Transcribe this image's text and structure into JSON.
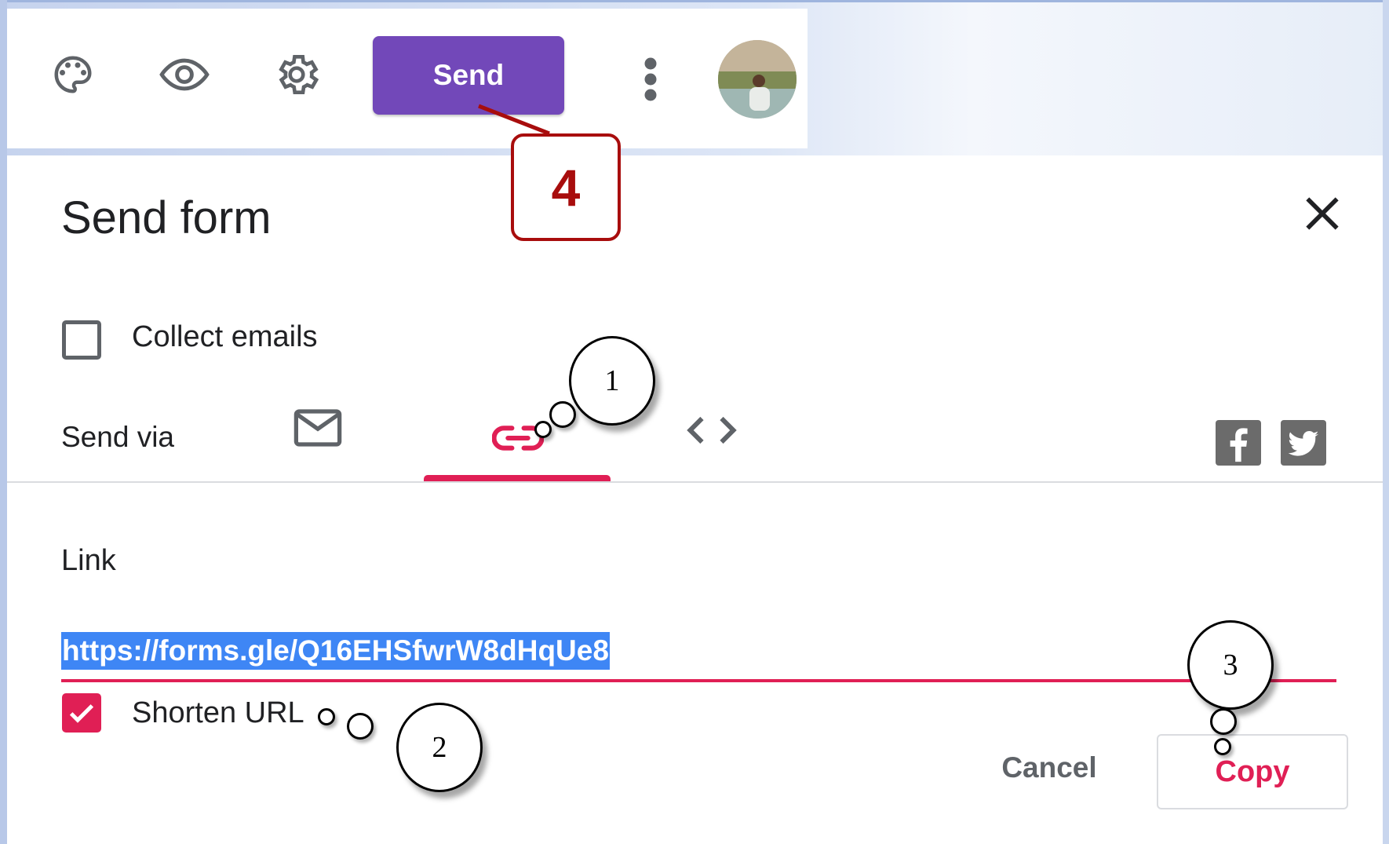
{
  "toolbar": {
    "icons": [
      "palette-icon",
      "eye-icon",
      "gear-icon",
      "more-vert-icon"
    ],
    "send_label": "Send"
  },
  "dialog": {
    "title": "Send form",
    "collect_emails_label": "Collect emails",
    "collect_emails_checked": false,
    "send_via_label": "Send via",
    "tabs": [
      {
        "icon": "email-icon",
        "selected": false
      },
      {
        "icon": "link-icon",
        "selected": true
      },
      {
        "icon": "embed-icon",
        "selected": false
      }
    ],
    "share_icons": [
      "facebook-icon",
      "twitter-icon"
    ],
    "link_label": "Link",
    "url": "https://forms.gle/Q16EHSfwrW8dHqUe8",
    "shorten_url_label": "Shorten URL",
    "shorten_url_checked": true,
    "cancel_label": "Cancel",
    "copy_label": "Copy"
  },
  "annotations": {
    "a1": "1",
    "a2": "2",
    "a3": "3",
    "a4": "4"
  },
  "colors": {
    "send_button": "#7248b9",
    "accent": "#e01f55",
    "selection": "#3e86f5",
    "callout": "#a80d0d"
  }
}
